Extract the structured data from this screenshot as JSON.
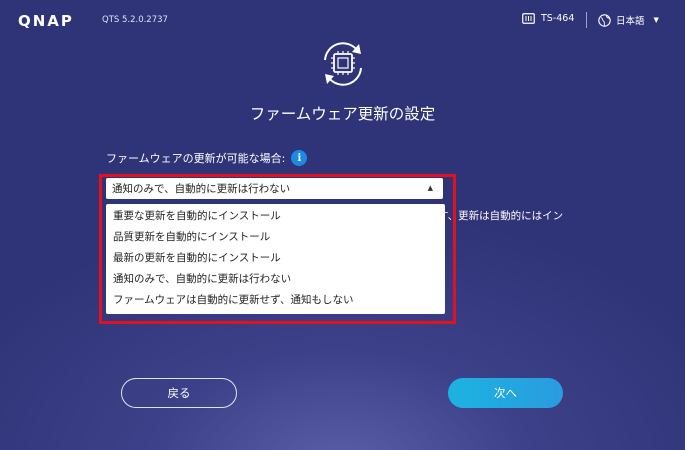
{
  "header": {
    "logo_text": "QNAP",
    "version": "QTS 5.2.0.2737",
    "device_name": "TS-464",
    "language": "日本語"
  },
  "page": {
    "title": "ファームウェア更新の設定",
    "prompt_label": "ファームウェアの更新が可能な場合:",
    "info_glyph": "i"
  },
  "update_select": {
    "selected": "通知のみで、自動的に更新は行わない",
    "options": [
      "重要な更新を自動的にインストール",
      "品質更新を自動的にインストール",
      "最新の更新を自動的にインストール",
      "通知のみで、自動的に更新は行わない",
      "ファームウェアは自動的に更新せず、通知もしない"
    ]
  },
  "background_note": "す、更新は自動的にはイン",
  "buttons": {
    "back": "戻る",
    "next": "次へ"
  },
  "colors": {
    "highlight": "#e3101e",
    "next_button": "#1cb3e0",
    "info_icon": "#1e88e5"
  }
}
